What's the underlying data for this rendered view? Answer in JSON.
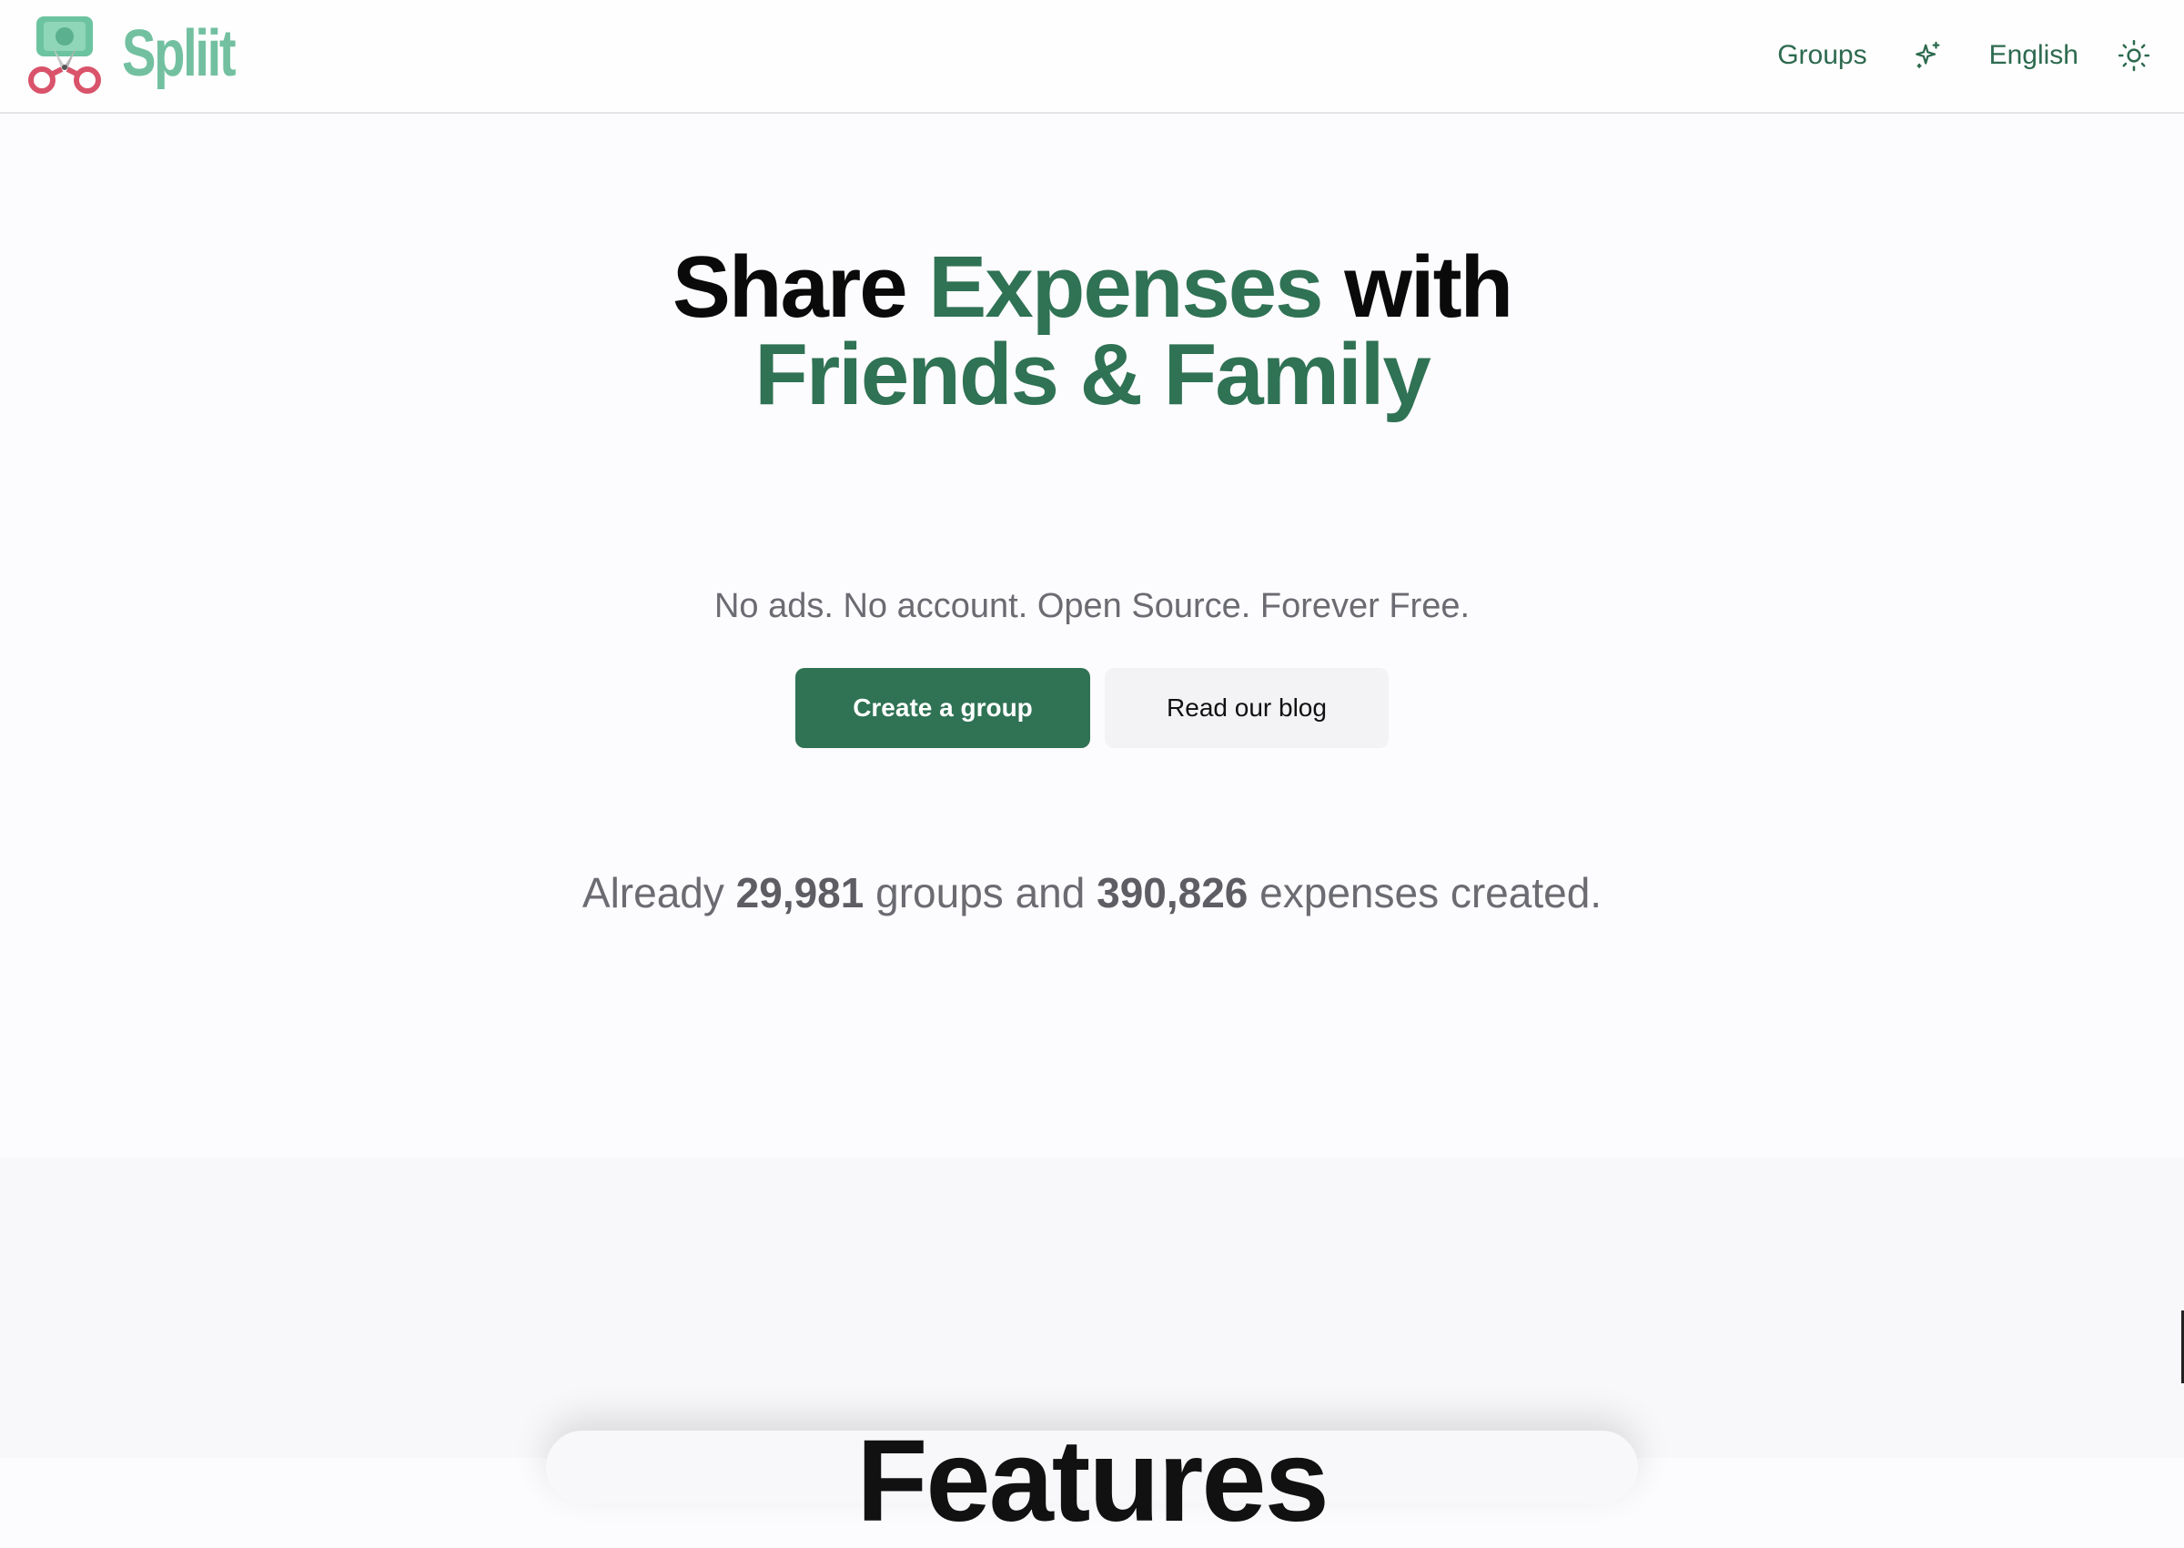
{
  "header": {
    "logo_text": "Spliit",
    "nav": {
      "groups_label": "Groups",
      "language_label": "English"
    },
    "icons": [
      "logo-icon",
      "sparkles-icon",
      "sun-icon"
    ],
    "accent_color": "#2f7254"
  },
  "hero": {
    "title_part1": "Share",
    "title_part2": "Expenses",
    "title_part3": "with",
    "title_line2": "Friends & Family",
    "subtitle": "No ads. No account. Open Source. Forever Free.",
    "primary_button": "Create a group",
    "secondary_button": "Read our blog",
    "stats": {
      "prefix": "Already",
      "groups_count": "29,981",
      "middle": "groups and",
      "expenses_count": "390,826",
      "suffix": "expenses created."
    }
  },
  "features": {
    "title": "Features"
  }
}
